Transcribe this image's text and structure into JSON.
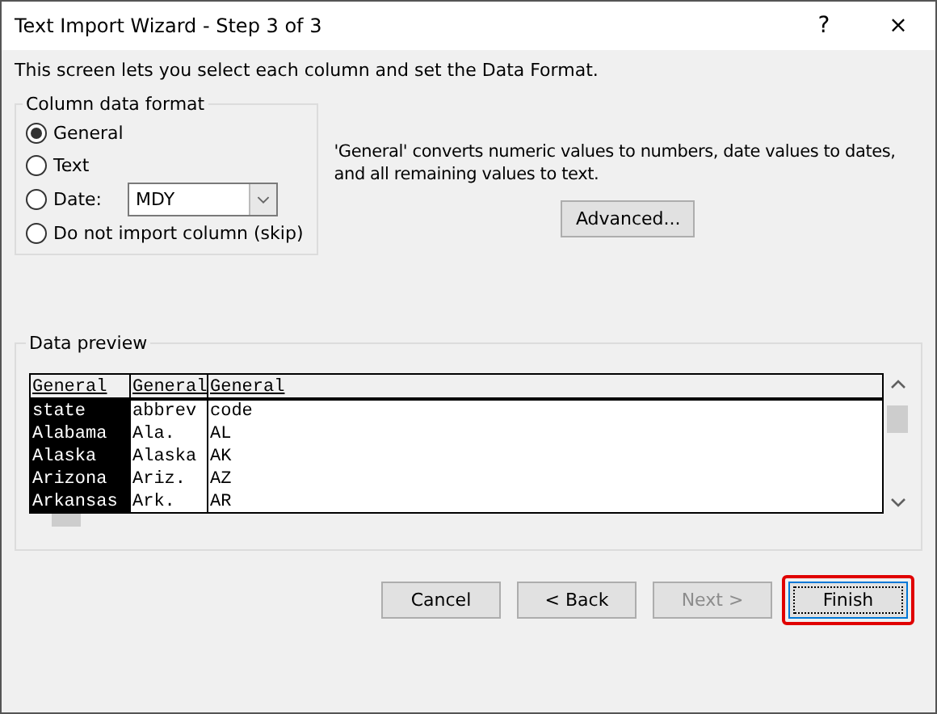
{
  "window": {
    "title": "Text Import Wizard - Step 3 of 3",
    "controls": [
      "?",
      "×"
    ]
  },
  "intro": "This screen lets you select each column and set the Data Format.",
  "column_data_format": {
    "legend": "Column data format",
    "options": [
      {
        "kind": "radio",
        "label": "General",
        "selected": true
      },
      {
        "kind": "radio",
        "label": "Text",
        "selected": false
      },
      {
        "kind": "radio-dropdown",
        "label": "Date:",
        "selected": false,
        "dropdown_value": "MDY"
      },
      {
        "kind": "radio",
        "label": "Do not import column (skip)",
        "selected": false
      }
    ]
  },
  "description": "'General' converts numeric values to numbers, date values to dates, and all remaining values to text.",
  "advanced_button": "Advanced...",
  "data_preview": {
    "legend": "Data preview",
    "columns": [
      {
        "header": "General",
        "selected": true,
        "cells": [
          "state",
          "Alabama",
          "Alaska",
          "Arizona",
          "Arkansas"
        ]
      },
      {
        "header": "General",
        "selected": false,
        "cells": [
          "abbrev",
          "Ala.",
          "Alaska",
          "Ariz.",
          "Ark."
        ]
      },
      {
        "header": "General",
        "selected": false,
        "cells": [
          "code",
          "AL",
          "AK",
          "AZ",
          "AR"
        ]
      }
    ]
  },
  "buttons": [
    {
      "label": "Cancel",
      "disabled": false,
      "highlighted": false
    },
    {
      "label": "< Back",
      "disabled": false,
      "highlighted": false
    },
    {
      "label": "Next >",
      "disabled": true,
      "highlighted": false
    },
    {
      "label": "Finish",
      "disabled": false,
      "highlighted": true
    }
  ]
}
